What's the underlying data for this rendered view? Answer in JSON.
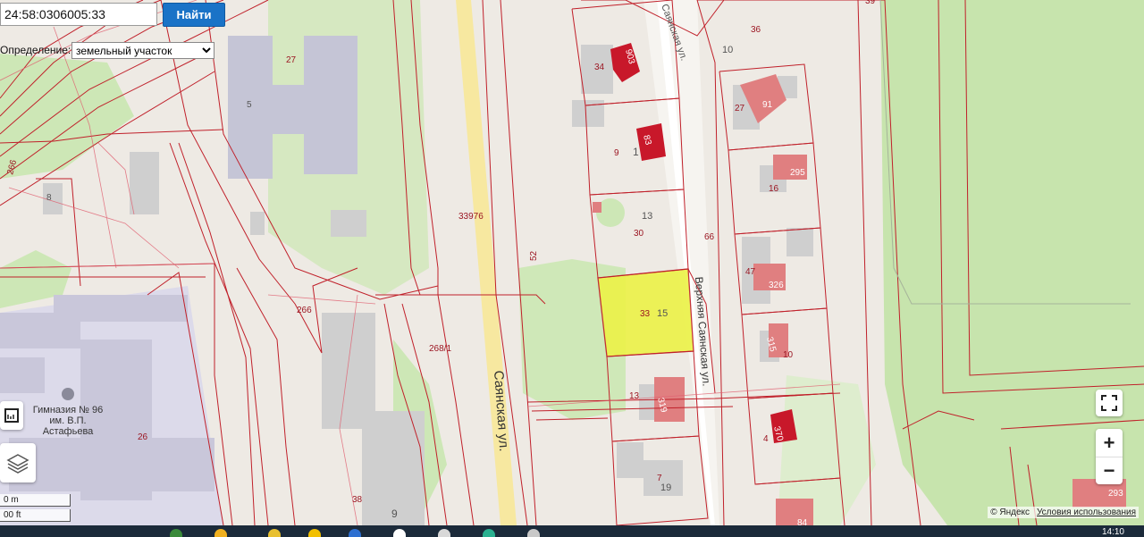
{
  "search": {
    "value": "24:58:0306005:33",
    "button_label": "Найти"
  },
  "definition": {
    "label": "Определение:",
    "selected": "земельный участок"
  },
  "streets": {
    "sayanskaya": "Саянская ул.",
    "verkhnyaya": "Верхняя Саянская ул.",
    "sayanskaya_top": "Саянская ул."
  },
  "school": {
    "line1": "Гимназия № 96",
    "line2": "им. В.П.",
    "line3": "Астафьева"
  },
  "parcel_labels": {
    "p27_top": "27",
    "p5": "5",
    "p266a": "266",
    "p8": "8",
    "p33976": "33976",
    "p52": "52",
    "p266b": "266",
    "p268": "268/1",
    "p26": "26",
    "p38": "38",
    "p9b": "9",
    "p34": "34",
    "p903": "903",
    "p9": "9",
    "p1": "1",
    "p83": "83",
    "p13": "13",
    "p30": "30",
    "p66": "66",
    "p33": "33",
    "p15": "15",
    "p13b": "13",
    "p319": "319",
    "p7": "7",
    "p19": "19",
    "p36": "36",
    "p10": "10",
    "p27b": "27",
    "p91": "91",
    "p295": "295",
    "p16": "16",
    "p47": "47",
    "p326": "326",
    "p315": "315",
    "p10b": "10",
    "p4": "4",
    "p370": "370",
    "p84": "84",
    "p293": "293",
    "p39": "39"
  },
  "scale": {
    "meters": "0 m",
    "feet": "00 ft"
  },
  "attribution": {
    "yandex": "© Яндекс",
    "terms": "Условия использования"
  },
  "clock": "14:10",
  "colors": {
    "boundary": "#c0202a",
    "selected_parcel": "#ecf24a",
    "building": "#e07f80",
    "building_dark": "#c8182a",
    "green": "#c9e6b0",
    "road": "#f5e79a",
    "button": "#1a73c7"
  }
}
